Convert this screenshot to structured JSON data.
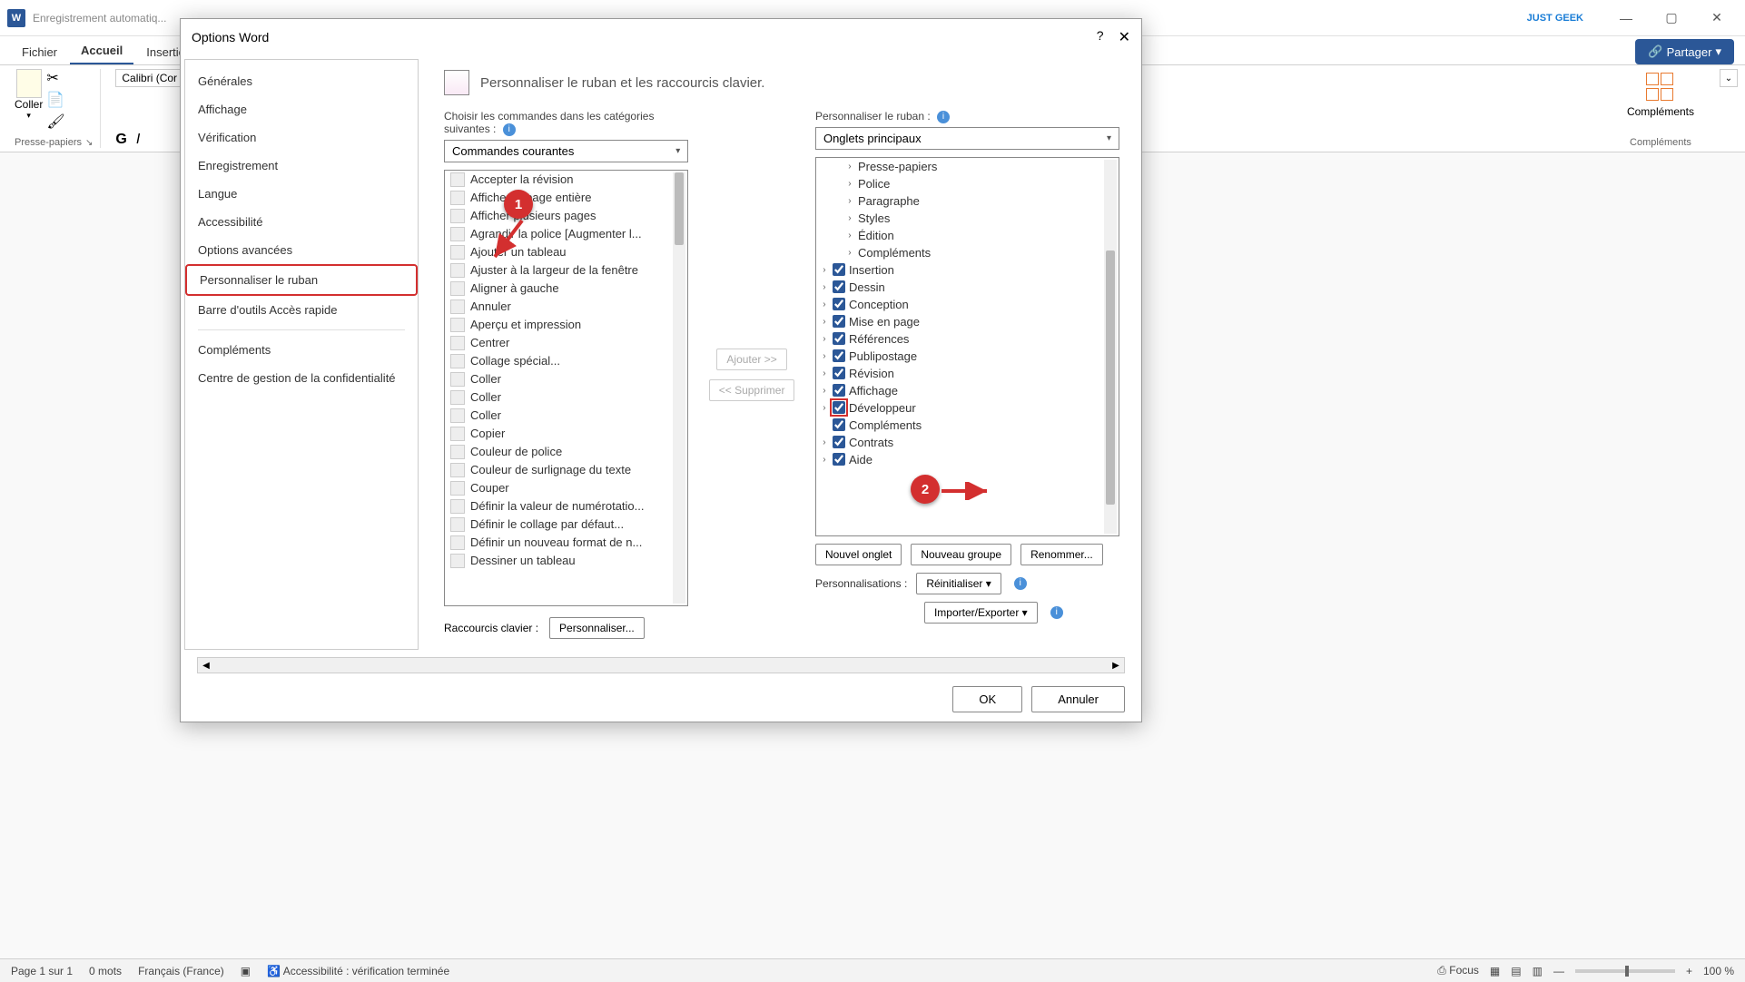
{
  "titlebar": {
    "app_icon": "W",
    "autosave": "Enregistrement automatiq...",
    "brand": "JUST GEEK"
  },
  "ribbon": {
    "tabs": {
      "file": "Fichier",
      "home": "Accueil",
      "insert": "Insertion"
    },
    "share": "Partager",
    "clipboard_group": "Presse-papiers",
    "paste": "Coller",
    "font_name": "Calibri (Cor",
    "addins_label": "Compléments",
    "addins_group": "Compléments"
  },
  "dialog": {
    "title": "Options Word",
    "nav": {
      "general": "Générales",
      "display": "Affichage",
      "proofing": "Vérification",
      "save": "Enregistrement",
      "language": "Langue",
      "accessibility": "Accessibilité",
      "advanced": "Options avancées",
      "customize_ribbon": "Personnaliser le ruban",
      "qat": "Barre d'outils Accès rapide",
      "addins": "Compléments",
      "trust_center": "Centre de gestion de la confidentialité"
    },
    "main_title": "Personnaliser le ruban et les raccourcis clavier.",
    "left_label": "Choisir les commandes dans les catégories suivantes :",
    "left_dropdown": "Commandes courantes",
    "right_label": "Personnaliser le ruban :",
    "right_dropdown": "Onglets principaux",
    "commands": [
      {
        "label": "Accepter la révision",
        "submenu": false
      },
      {
        "label": "Afficher la page entière",
        "submenu": false
      },
      {
        "label": "Afficher plusieurs pages",
        "submenu": false
      },
      {
        "label": "Agrandir la police [Augmenter l...",
        "submenu": false
      },
      {
        "label": "Ajouter un tableau",
        "submenu": true
      },
      {
        "label": "Ajuster à la largeur de la fenêtre",
        "submenu": false
      },
      {
        "label": "Aligner à gauche",
        "submenu": false
      },
      {
        "label": "Annuler",
        "submenu": true
      },
      {
        "label": "Aperçu et impression",
        "submenu": false
      },
      {
        "label": "Centrer",
        "submenu": false
      },
      {
        "label": "Collage spécial...",
        "submenu": false
      },
      {
        "label": "Coller",
        "submenu": true
      },
      {
        "label": "Coller",
        "submenu": false
      },
      {
        "label": "Coller",
        "submenu": true
      },
      {
        "label": "Copier",
        "submenu": false
      },
      {
        "label": "Couleur de police",
        "submenu": true
      },
      {
        "label": "Couleur de surlignage du texte",
        "submenu": true
      },
      {
        "label": "Couper",
        "submenu": false
      },
      {
        "label": "Définir la valeur de numérotatio...",
        "submenu": false
      },
      {
        "label": "Définir le collage par défaut...",
        "submenu": false
      },
      {
        "label": "Définir un nouveau format de n...",
        "submenu": false
      },
      {
        "label": "Dessiner un tableau",
        "submenu": false
      }
    ],
    "tree_groups": [
      "Presse-papiers",
      "Police",
      "Paragraphe",
      "Styles",
      "Édition",
      "Compléments"
    ],
    "tree_tabs": [
      {
        "label": "Insertion",
        "checked": true
      },
      {
        "label": "Dessin",
        "checked": true
      },
      {
        "label": "Conception",
        "checked": true
      },
      {
        "label": "Mise en page",
        "checked": true
      },
      {
        "label": "Références",
        "checked": true
      },
      {
        "label": "Publipostage",
        "checked": true
      },
      {
        "label": "Révision",
        "checked": true
      },
      {
        "label": "Affichage",
        "checked": true
      },
      {
        "label": "Développeur",
        "checked": true,
        "highlight": true
      },
      {
        "label": "Compléments",
        "checked": true,
        "no_chev": true
      },
      {
        "label": "Contrats",
        "checked": true
      },
      {
        "label": "Aide",
        "checked": true
      }
    ],
    "add_btn": "Ajouter >>",
    "remove_btn": "<< Supprimer",
    "new_tab": "Nouvel onglet",
    "new_group": "Nouveau groupe",
    "rename": "Renommer...",
    "customizations_label": "Personnalisations :",
    "reset": "Réinitialiser",
    "import_export": "Importer/Exporter",
    "shortcuts_label": "Raccourcis clavier :",
    "customize_btn": "Personnaliser...",
    "ok": "OK",
    "cancel": "Annuler"
  },
  "annotations": {
    "one": "1",
    "two": "2"
  },
  "status": {
    "page": "Page 1 sur 1",
    "words": "0 mots",
    "lang": "Français (France)",
    "access": "Accessibilité : vérification terminée",
    "focus": "Focus",
    "zoom": "100 %"
  }
}
